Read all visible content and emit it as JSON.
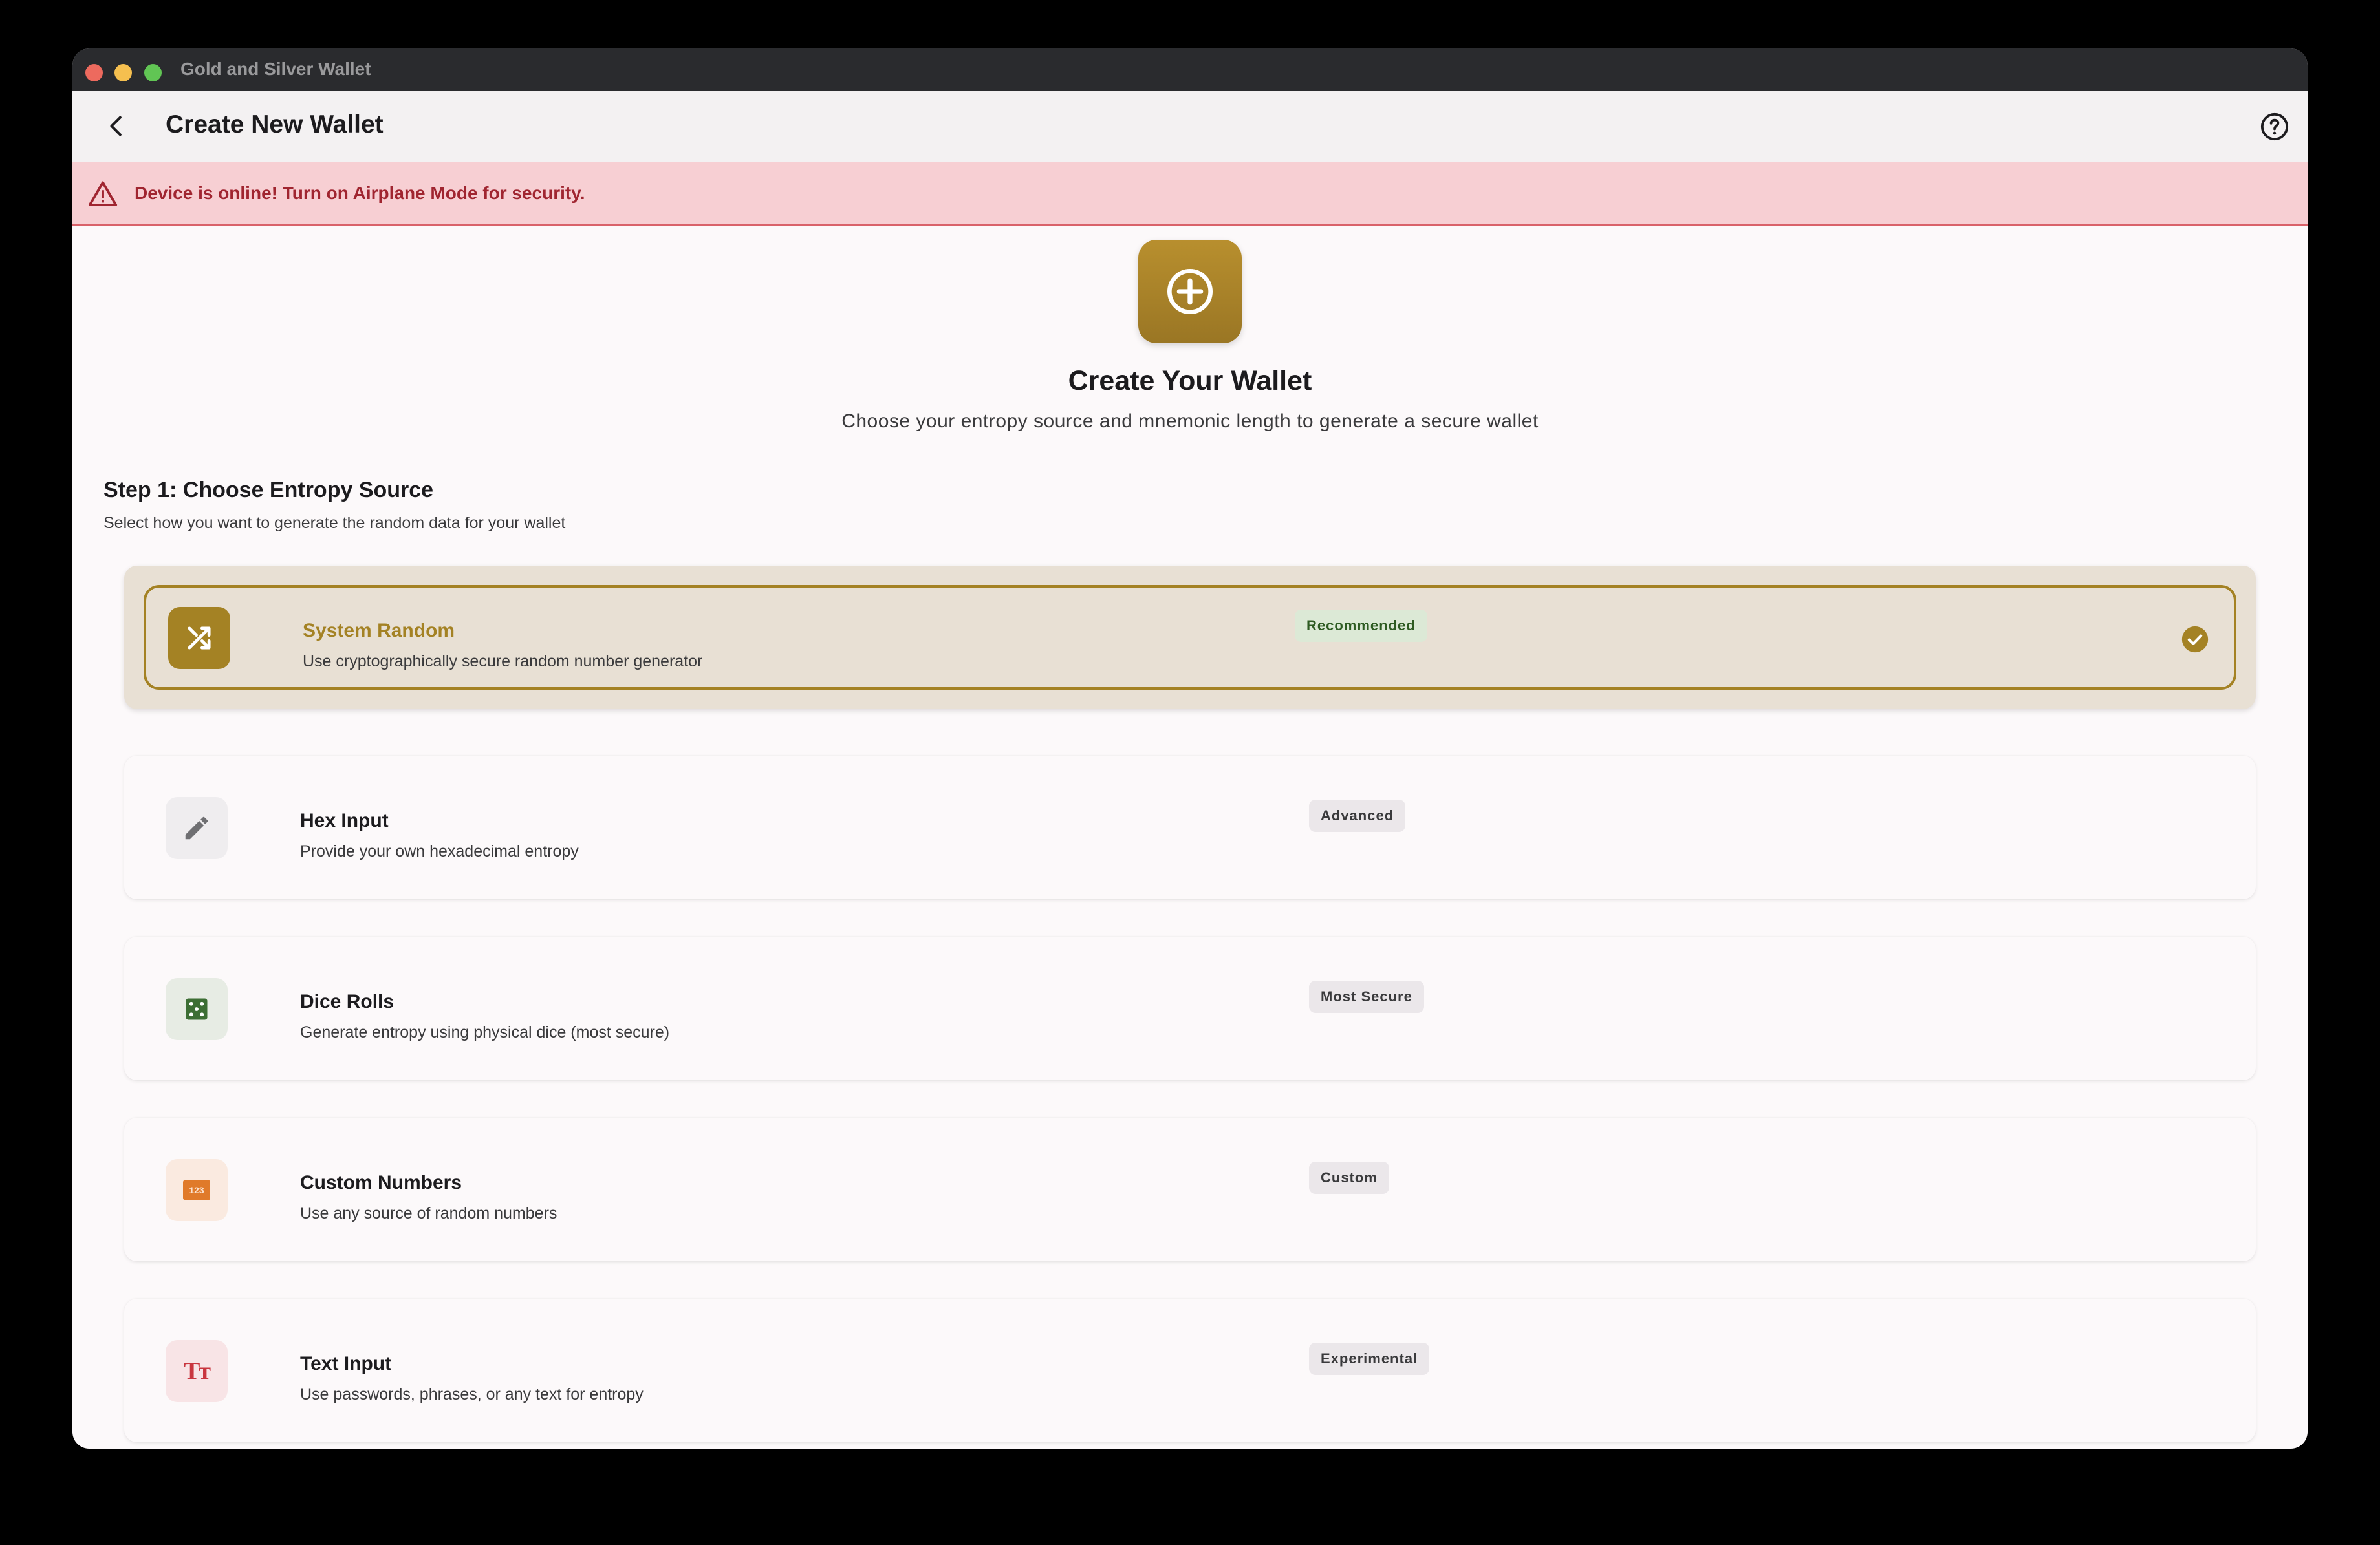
{
  "window": {
    "title": "Gold and Silver Wallet"
  },
  "appbar": {
    "title": "Create New Wallet",
    "back_icon": "back-arrow-icon",
    "help_icon": "help-circle-icon"
  },
  "alert": {
    "text": "Device is online! Turn on Airplane Mode for security.",
    "icon": "warning-triangle-icon",
    "color": "#a02530"
  },
  "hero": {
    "icon": "add-circle-icon",
    "title": "Create Your Wallet",
    "subtitle": "Choose your entropy source and mnemonic length to generate a secure wallet"
  },
  "step1": {
    "title": "Step 1: Choose Entropy Source",
    "subtitle": "Select how you want to generate the random data for your wallet"
  },
  "options": [
    {
      "title": "System Random",
      "subtitle": "Use cryptographically secure random number generator",
      "badge": "Recommended",
      "icon": "shuffle-icon",
      "selected": true
    },
    {
      "title": "Hex Input",
      "subtitle": "Provide your own hexadecimal entropy",
      "badge": "Advanced",
      "icon": "pencil-icon",
      "selected": false
    },
    {
      "title": "Dice Rolls",
      "subtitle": "Generate entropy using physical dice (most secure)",
      "badge": "Most Secure",
      "icon": "dice-icon",
      "selected": false
    },
    {
      "title": "Custom Numbers",
      "subtitle": "Use any source of random numbers",
      "badge": "Custom",
      "icon": "numbers-icon",
      "icon_text": "123",
      "selected": false
    },
    {
      "title": "Text Input",
      "subtitle": "Use passwords, phrases, or any text for entropy",
      "badge": "Experimental",
      "icon": "text-size-icon",
      "icon_text": "Tт",
      "selected": false
    }
  ],
  "colors": {
    "accent": "#a48224",
    "alert_bg": "#f7cfd3",
    "selected_bg": "#e8e0d4"
  }
}
